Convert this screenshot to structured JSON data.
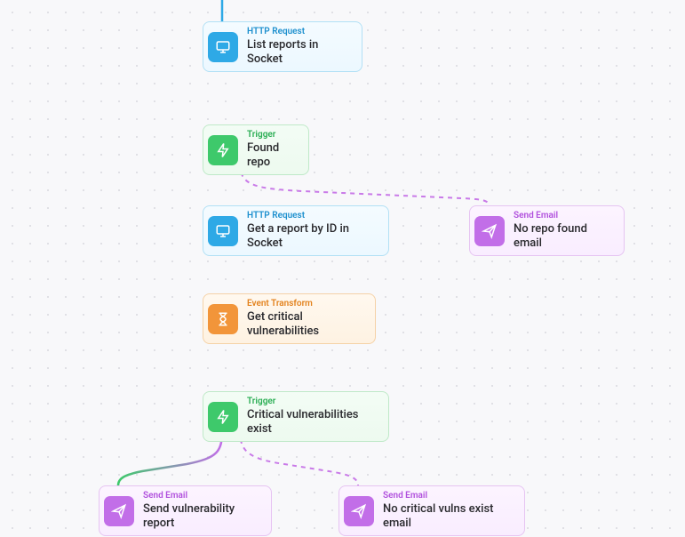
{
  "nodes": {
    "listReports": {
      "type": "HTTP Request",
      "title": "List reports in Socket"
    },
    "foundRepo": {
      "type": "Trigger",
      "title": "Found repo"
    },
    "getReport": {
      "type": "HTTP Request",
      "title": "Get a report by ID in Socket"
    },
    "noRepoEmail": {
      "type": "Send Email",
      "title": "No repo found email"
    },
    "getCritical": {
      "type": "Event Transform",
      "title": "Get critical vulnerabilities"
    },
    "critExist": {
      "type": "Trigger",
      "title": "Critical vulnerabilities exist"
    },
    "sendReport": {
      "type": "Send Email",
      "title": "Send vulnerability report"
    },
    "noCritEmail": {
      "type": "Send Email",
      "title": "No critical vulns exist email"
    }
  },
  "colors": {
    "blue": "#2ea9e6",
    "green": "#3ec96b",
    "orange": "#f2953a",
    "purple": "#c26ee8",
    "purpleDash": "#c97ae8"
  }
}
